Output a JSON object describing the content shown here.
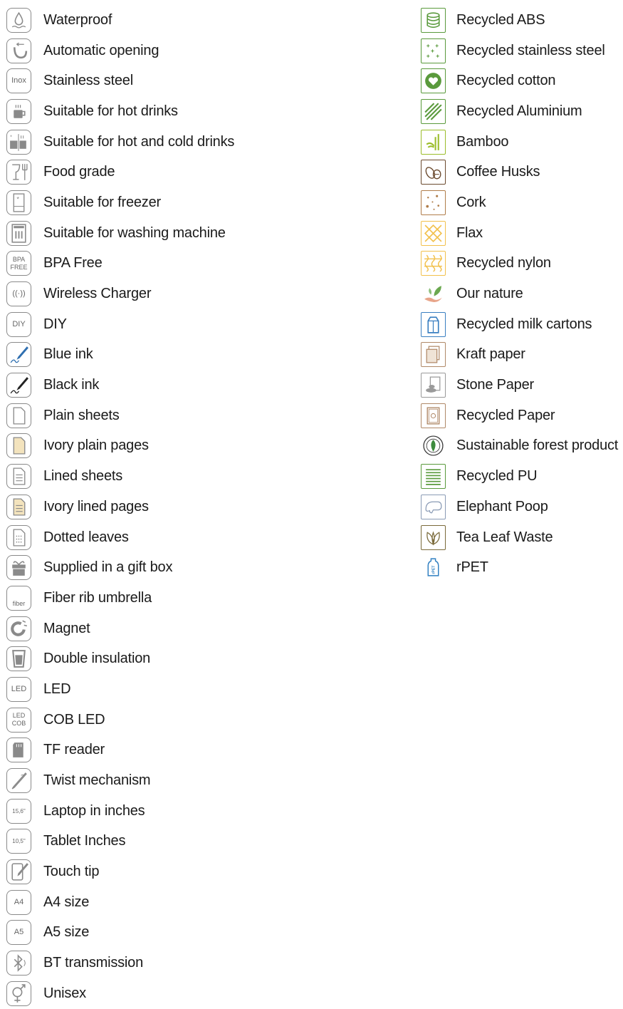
{
  "left_items": [
    {
      "label": "Waterproof",
      "icon": "water-drop-icon",
      "color": "#8a8a8a"
    },
    {
      "label": "Automatic opening",
      "icon": "auto-open-icon",
      "color": "#8a8a8a"
    },
    {
      "label": "Stainless steel",
      "icon": "inox-icon",
      "text": "Inox",
      "color": "#8a8a8a"
    },
    {
      "label": "Suitable for hot drinks",
      "icon": "hot-drink-icon",
      "color": "#8a8a8a"
    },
    {
      "label": "Suitable for hot and cold drinks",
      "icon": "hot-cold-drink-icon",
      "color": "#8a8a8a"
    },
    {
      "label": "Food grade",
      "icon": "glass-fork-icon",
      "color": "#8a8a8a"
    },
    {
      "label": "Suitable for freezer",
      "icon": "freezer-icon",
      "color": "#8a8a8a"
    },
    {
      "label": "Suitable for washing machine",
      "icon": "dishwasher-icon",
      "color": "#8a8a8a"
    },
    {
      "label": "BPA Free",
      "icon": "bpa-free-icon",
      "text": "BPA FREE",
      "color": "#8a8a8a"
    },
    {
      "label": "Wireless Charger",
      "icon": "wireless-icon",
      "text": "((·))",
      "color": "#8a8a8a"
    },
    {
      "label": "DIY",
      "icon": "diy-icon",
      "text": "DIY",
      "color": "#8a8a8a"
    },
    {
      "label": "Blue ink",
      "icon": "blue-pen-icon",
      "color": "#2f6fb0"
    },
    {
      "label": "Black ink",
      "icon": "black-pen-icon",
      "color": "#222222"
    },
    {
      "label": "Plain sheets",
      "icon": "plain-sheet-icon",
      "color": "#8a8a8a"
    },
    {
      "label": "Ivory plain pages",
      "icon": "ivory-sheet-icon",
      "color": "#f3e3bd"
    },
    {
      "label": "Lined sheets",
      "icon": "lined-sheet-icon",
      "color": "#8a8a8a"
    },
    {
      "label": "Ivory lined pages",
      "icon": "ivory-lined-sheet-icon",
      "color": "#f3e3bd"
    },
    {
      "label": "Dotted leaves",
      "icon": "dotted-sheet-icon",
      "color": "#8a8a8a"
    },
    {
      "label": "Supplied in a gift box",
      "icon": "gift-box-icon",
      "color": "#8a8a8a"
    },
    {
      "label": "Fiber rib umbrella",
      "icon": "umbrella-icon",
      "text": "fiber",
      "color": "#8a8a8a"
    },
    {
      "label": "Magnet",
      "icon": "magnet-icon",
      "color": "#8a8a8a"
    },
    {
      "label": "Double insulation",
      "icon": "insulation-icon",
      "color": "#8a8a8a"
    },
    {
      "label": "LED",
      "icon": "led-icon",
      "text": "LED",
      "color": "#8a8a8a"
    },
    {
      "label": "COB LED",
      "icon": "cob-led-icon",
      "text": "LED COB",
      "color": "#8a8a8a"
    },
    {
      "label": "TF reader",
      "icon": "sd-card-icon",
      "color": "#8a8a8a"
    },
    {
      "label": "Twist mechanism",
      "icon": "twist-pen-icon",
      "color": "#8a8a8a"
    },
    {
      "label": "Laptop in inches",
      "icon": "laptop-icon",
      "text": "15,6\"",
      "color": "#8a8a8a"
    },
    {
      "label": "Tablet Inches",
      "icon": "tablet-icon",
      "text": "10,5\"",
      "color": "#8a8a8a"
    },
    {
      "label": "Touch tip",
      "icon": "touch-tip-icon",
      "color": "#8a8a8a"
    },
    {
      "label": "A4 size",
      "icon": "a4-icon",
      "text": "A4",
      "color": "#8a8a8a"
    },
    {
      "label": "A5 size",
      "icon": "a5-icon",
      "text": "A5",
      "color": "#8a8a8a"
    },
    {
      "label": "BT transmission",
      "icon": "bluetooth-icon",
      "color": "#8a8a8a"
    },
    {
      "label": "Unisex",
      "icon": "unisex-icon",
      "color": "#8a8a8a"
    }
  ],
  "right_items": [
    {
      "label": "Recycled ABS",
      "icon": "recycled-abs-icon",
      "color": "#5a9a3c"
    },
    {
      "label": "Recycled stainless steel",
      "icon": "recycled-steel-icon",
      "color": "#5a9a3c"
    },
    {
      "label": "Recycled cotton",
      "icon": "recycled-cotton-icon",
      "color": "#5a9a3c"
    },
    {
      "label": "Recycled Aluminium",
      "icon": "recycled-aluminium-icon",
      "color": "#5a9a3c"
    },
    {
      "label": "Bamboo",
      "icon": "bamboo-icon",
      "color": "#9bbd2a"
    },
    {
      "label": "Coffee Husks",
      "icon": "coffee-husks-icon",
      "color": "#6b4a2e"
    },
    {
      "label": "Cork",
      "icon": "cork-icon",
      "color": "#b07d4a"
    },
    {
      "label": "Flax",
      "icon": "flax-icon",
      "color": "#f2c14e"
    },
    {
      "label": "Recycled nylon",
      "icon": "recycled-nylon-icon",
      "color": "#f2c14e"
    },
    {
      "label": "Our nature",
      "icon": "our-nature-icon",
      "color": "#6aa84f"
    },
    {
      "label": "Recycled milk cartons",
      "icon": "milk-carton-icon",
      "color": "#3a7fc1"
    },
    {
      "label": "Kraft paper",
      "icon": "kraft-paper-icon",
      "color": "#b08968"
    },
    {
      "label": "Stone Paper",
      "icon": "stone-paper-icon",
      "color": "#9a9a9a"
    },
    {
      "label": "Recycled Paper",
      "icon": "recycled-paper-icon",
      "color": "#b08968"
    },
    {
      "label": "Sustainable forest product",
      "icon": "sustainable-forest-icon",
      "color": "#3d8b3d"
    },
    {
      "label": "Recycled PU",
      "icon": "recycled-pu-icon",
      "color": "#5a9a3c"
    },
    {
      "label": "Elephant Poop",
      "icon": "elephant-poop-icon",
      "color": "#8a9bb5"
    },
    {
      "label": "Tea Leaf Waste",
      "icon": "tea-leaf-icon",
      "color": "#7a6a3a"
    },
    {
      "label": "rPET",
      "icon": "rpet-icon",
      "text": "rPET",
      "color": "#2f7fc1"
    }
  ]
}
